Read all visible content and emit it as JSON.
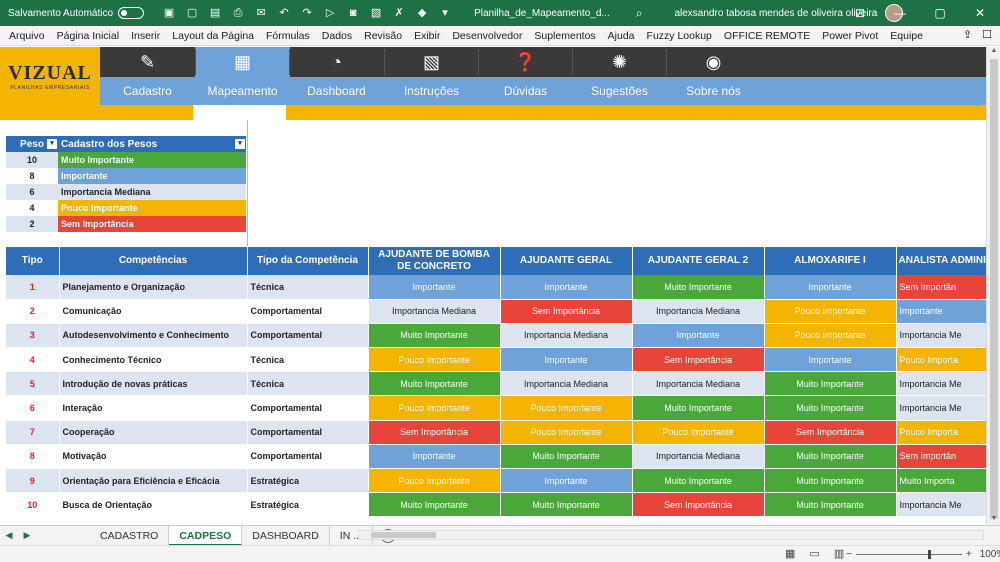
{
  "titlebar": {
    "autosave_label": "Salvamento Automático",
    "doc_title": "Planilha_de_Mapeamento_d...",
    "user_name": "alexsandro tabosa mendes de oliveira oliveira"
  },
  "menu": [
    "Arquivo",
    "Página Inicial",
    "Inserir",
    "Layout da Página",
    "Fórmulas",
    "Dados",
    "Revisão",
    "Exibir",
    "Desenvolvedor",
    "Suplementos",
    "Ajuda",
    "Fuzzy Lookup",
    "OFFICE REMOTE",
    "Power Pivot",
    "Equipe"
  ],
  "logo": {
    "brand": "VIZUAL",
    "tagline": "PLANILHAS EMPRESARIAIS"
  },
  "nav": [
    {
      "label": "Cadastro",
      "icon": "pencil-icon"
    },
    {
      "label": "Mapeamento",
      "icon": "map-icon"
    },
    {
      "label": "Dashboard",
      "icon": "pie-chart-icon"
    },
    {
      "label": "Instruções",
      "icon": "presentation-icon"
    },
    {
      "label": "Dúvidas",
      "icon": "question-people-icon"
    },
    {
      "label": "Sugestões",
      "icon": "lightbulb-icon"
    },
    {
      "label": "Sobre nós",
      "icon": "owl-icon"
    }
  ],
  "weights": {
    "header": [
      "Peso",
      "Cadastro dos Pesos"
    ],
    "rows": [
      {
        "value": "10",
        "label": "Muito Importante",
        "color": "#4aa83a"
      },
      {
        "value": "8",
        "label": "Importante",
        "color": "#6fa2d8"
      },
      {
        "value": "6",
        "label": "Importancia Mediana",
        "color": "#dce4f0"
      },
      {
        "value": "4",
        "label": "Pouco Importante",
        "color": "#f4b400"
      },
      {
        "value": "2",
        "label": "Sem Importância",
        "color": "#e8443a"
      }
    ]
  },
  "grid": {
    "headers": [
      "Tipo",
      "Competências",
      "Tipo da Competência",
      "AJUDANTE DE BOMBA DE CONCRETO",
      "AJUDANTE GERAL",
      "AJUDANTE GERAL 2",
      "ALMOXARIFE I",
      "ANALISTA ADMINIS"
    ],
    "rows": [
      {
        "tipo": "1",
        "comp": "Planejamento e Organização",
        "tc": "Técnica",
        "vals": [
          "Importante",
          "Importante",
          "Muito Importante",
          "Importante",
          "Sem Importân"
        ]
      },
      {
        "tipo": "2",
        "comp": "Comunicação",
        "tc": "Comportamental",
        "vals": [
          "Importancia Mediana",
          "Sem Importância",
          "Importancia Mediana",
          "Pouco Importante",
          "Importante"
        ]
      },
      {
        "tipo": "3",
        "comp": "Autodesenvolvimento e Conhecimento",
        "tc": "Comportamental",
        "vals": [
          "Muito Importante",
          "Importancia Mediana",
          "Importante",
          "Pouco Importante",
          "Importancia Me"
        ]
      },
      {
        "tipo": "4",
        "comp": "Conhecimento Técnico",
        "tc": "Técnica",
        "vals": [
          "Pouco Importante",
          "Importante",
          "Sem Importância",
          "Importante",
          "Pouco Importa"
        ]
      },
      {
        "tipo": "5",
        "comp": "Introdução de novas práticas",
        "tc": "Técnica",
        "vals": [
          "Muito Importante",
          "Importancia Mediana",
          "Importancia Mediana",
          "Muito Importante",
          "Importancia Me"
        ]
      },
      {
        "tipo": "6",
        "comp": "Interação",
        "tc": "Comportamental",
        "vals": [
          "Pouco Importante",
          "Pouco Importante",
          "Muito Importante",
          "Muito Importante",
          "Importancia Me"
        ]
      },
      {
        "tipo": "7",
        "comp": "Cooperação",
        "tc": "Comportamental",
        "vals": [
          "Sem Importância",
          "Pouco Importante",
          "Pouco Importante",
          "Sem Importância",
          "Pouco Importa"
        ]
      },
      {
        "tipo": "8",
        "comp": "Motivação",
        "tc": "Comportamental",
        "vals": [
          "Importante",
          "Muito Importante",
          "Importancia Mediana",
          "Muito Importante",
          "Sem Importân"
        ]
      },
      {
        "tipo": "9",
        "comp": "Orientação para Eficiência e Eficácia",
        "tc": "Estratégica",
        "vals": [
          "Pouco Importante",
          "Importante",
          "Muito Importante",
          "Muito Importante",
          "Muito Importa"
        ]
      },
      {
        "tipo": "10",
        "comp": "Busca de Orientação",
        "tc": "Estratégica",
        "vals": [
          "Muito Importante",
          "Muito Importante",
          "Sem Importância",
          "Muito Importante",
          "Importancia Me"
        ]
      }
    ]
  },
  "sheets": [
    "CADASTRO",
    "CADPESO",
    "DASHBOARD",
    "IN ..."
  ],
  "active_sheet": "CADPESO",
  "zoom": "100%",
  "colors": {
    "excel_green": "#1e7145",
    "header_blue": "#2e6db8",
    "row_alt": "#dce4f0"
  }
}
